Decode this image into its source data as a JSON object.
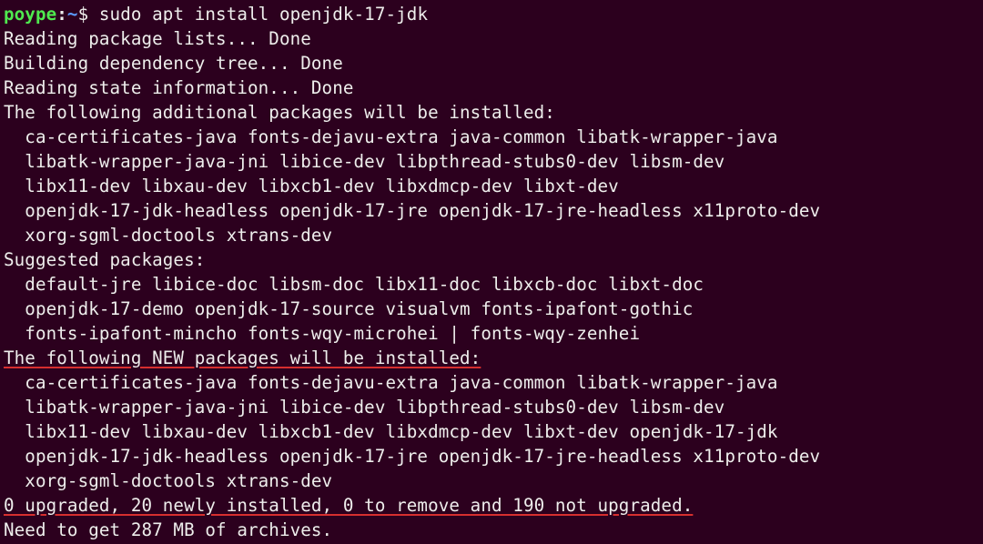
{
  "prompt": {
    "user": "poype",
    "sep1": ":",
    "path": "~",
    "sep2": "$ ",
    "command": "sudo apt install openjdk-17-jdk"
  },
  "lines": {
    "l1": "Reading package lists... Done",
    "l2": "Building dependency tree... Done",
    "l3": "Reading state information... Done",
    "l4": "The following additional packages will be installed:",
    "l5": "  ca-certificates-java fonts-dejavu-extra java-common libatk-wrapper-java",
    "l6": "  libatk-wrapper-java-jni libice-dev libpthread-stubs0-dev libsm-dev",
    "l7": "  libx11-dev libxau-dev libxcb1-dev libxdmcp-dev libxt-dev",
    "l8": "  openjdk-17-jdk-headless openjdk-17-jre openjdk-17-jre-headless x11proto-dev",
    "l9": "  xorg-sgml-doctools xtrans-dev",
    "l10": "Suggested packages:",
    "l11": "  default-jre libice-doc libsm-doc libx11-doc libxcb-doc libxt-doc",
    "l12": "  openjdk-17-demo openjdk-17-source visualvm fonts-ipafont-gothic",
    "l13": "  fonts-ipafont-mincho fonts-wqy-microhei | fonts-wqy-zenhei",
    "l14": "The following NEW packages will be installed:",
    "l15": "  ca-certificates-java fonts-dejavu-extra java-common libatk-wrapper-java",
    "l16": "  libatk-wrapper-java-jni libice-dev libpthread-stubs0-dev libsm-dev",
    "l17": "  libx11-dev libxau-dev libxcb1-dev libxdmcp-dev libxt-dev openjdk-17-jdk",
    "l18": "  openjdk-17-jdk-headless openjdk-17-jre openjdk-17-jre-headless x11proto-dev",
    "l19": "  xorg-sgml-doctools xtrans-dev",
    "l20": "0 upgraded, 20 newly installed, 0 to remove and 190 not upgraded.",
    "l21": "Need to get 287 MB of archives."
  }
}
